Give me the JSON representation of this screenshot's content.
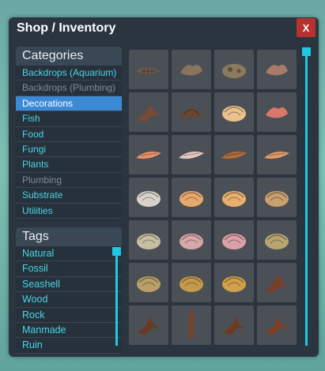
{
  "window": {
    "title": "Shop / Inventory",
    "close_label": "X"
  },
  "categories": {
    "header": "Categories",
    "items": [
      {
        "label": "Backdrops (Aquarium)",
        "state": "normal"
      },
      {
        "label": "Backdrops (Plumbing)",
        "state": "dim"
      },
      {
        "label": "Decorations",
        "state": "selected"
      },
      {
        "label": "Fish",
        "state": "normal"
      },
      {
        "label": "Food",
        "state": "normal"
      },
      {
        "label": "Fungi",
        "state": "normal"
      },
      {
        "label": "Plants",
        "state": "normal"
      },
      {
        "label": "Plumbing",
        "state": "dim"
      },
      {
        "label": "Substrate",
        "state": "normal"
      },
      {
        "label": "Utilities",
        "state": "normal"
      }
    ]
  },
  "tags": {
    "header": "Tags",
    "items": [
      "Natural",
      "Fossil",
      "Seashell",
      "Wood",
      "Rock",
      "Manmade",
      "Ruin"
    ]
  },
  "colors": {
    "accent": "#1ec9e3",
    "selected": "#3c8ad6",
    "close": "#b7312f"
  },
  "inventory": [
    {
      "name": "fossil-fish-icon",
      "fill": "#6c5a4c"
    },
    {
      "name": "ammonite-shell-icon",
      "fill": "#8a7360"
    },
    {
      "name": "dinosaur-skull-icon",
      "fill": "#8c7a5e"
    },
    {
      "name": "fossil-bone-icon",
      "fill": "#a87a6a"
    },
    {
      "name": "driftwood-icon",
      "fill": "#7a4a33"
    },
    {
      "name": "coconut-shell-icon",
      "fill": "#6b4630"
    },
    {
      "name": "scallop-shell-icon",
      "fill": "#e8c28a"
    },
    {
      "name": "coral-shell-icon",
      "fill": "#d9786a"
    },
    {
      "name": "conch-shell-icon",
      "fill": "#e8906a"
    },
    {
      "name": "auger-shell-icon",
      "fill": "#e3c8c0"
    },
    {
      "name": "cone-shell-icon",
      "fill": "#b56a38"
    },
    {
      "name": "spiral-shell-icon",
      "fill": "#e09a66"
    },
    {
      "name": "clam-shell-white-icon",
      "fill": "#d8d4cc"
    },
    {
      "name": "clam-shell-orange-icon",
      "fill": "#e8a96c"
    },
    {
      "name": "clam-shell-yellow-icon",
      "fill": "#e8b070"
    },
    {
      "name": "clam-shell-tan-icon",
      "fill": "#c9a070"
    },
    {
      "name": "clam-shell-grey-icon",
      "fill": "#c8bea2"
    },
    {
      "name": "clam-shell-pink-icon",
      "fill": "#d8a8a8"
    },
    {
      "name": "clam-shell-rose-icon",
      "fill": "#dca0a8"
    },
    {
      "name": "clam-shell-olive-icon",
      "fill": "#b8a670"
    },
    {
      "name": "clam-shell-khaki-icon",
      "fill": "#b8a068"
    },
    {
      "name": "clam-shell-gold-icon",
      "fill": "#c69a4c"
    },
    {
      "name": "clam-shell-amber-icon",
      "fill": "#d0a04a"
    },
    {
      "name": "wood-chip-icon",
      "fill": "#7a3e24"
    },
    {
      "name": "root-wood-icon",
      "fill": "#6a3a24"
    },
    {
      "name": "wood-stick-icon",
      "fill": "#7a4328"
    },
    {
      "name": "branch-small-icon",
      "fill": "#6e3a22"
    },
    {
      "name": "branch-twig-icon",
      "fill": "#7a4026"
    }
  ]
}
